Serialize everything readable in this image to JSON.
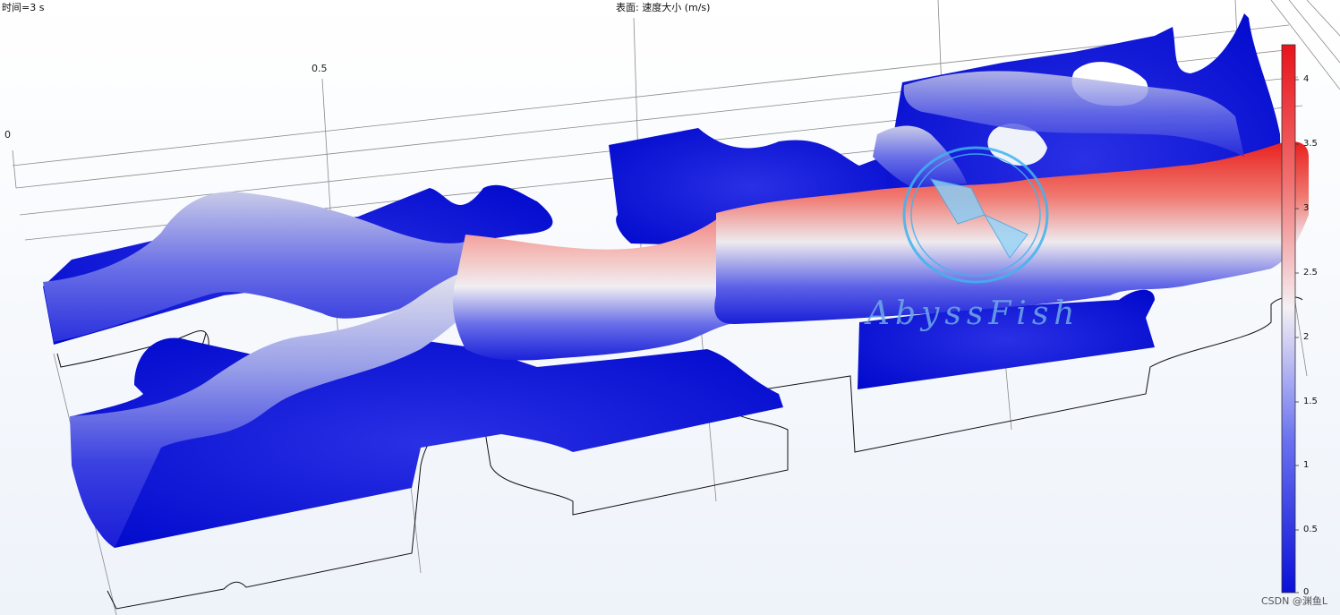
{
  "header": {
    "time_label": "时间=3 s",
    "surface_title": "表面: 速度大小 (m/s)"
  },
  "axis": {
    "tick_0": "0",
    "tick_05": "0.5"
  },
  "colorbar": {
    "ticks": [
      "4",
      "3.5",
      "3",
      "2.5",
      "2",
      "1.5",
      "1",
      "0.5",
      "0"
    ],
    "max_value": 4.3,
    "min_value": 0,
    "colors": {
      "high": "#e8141c",
      "mid": "#f4f0f4",
      "low": "#0a10d8"
    }
  },
  "watermark": {
    "text": "AbyssFish",
    "icon": "fish-in-circle-logo"
  },
  "credit": "CSDN @渊鱼L"
}
